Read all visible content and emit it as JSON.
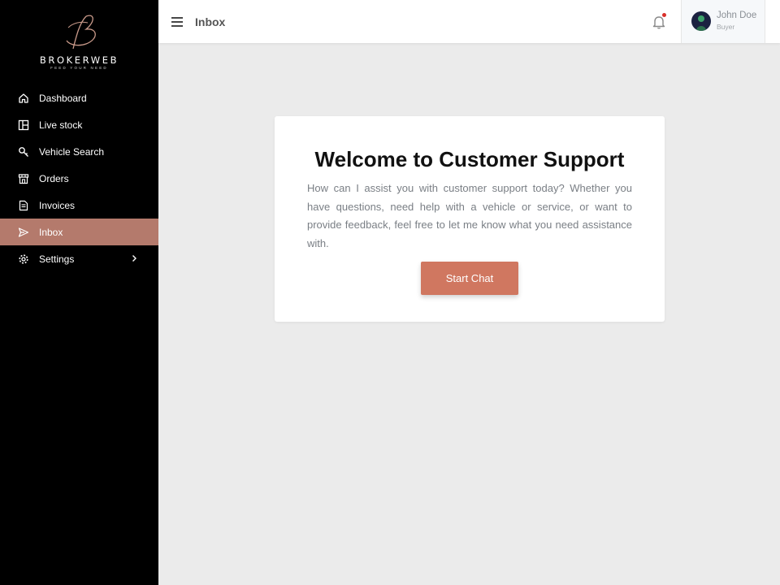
{
  "brand": {
    "name": "BROKERWEB",
    "tagline": "FEED YOUR NEED"
  },
  "sidebar": {
    "items": [
      {
        "label": "Dashboard",
        "icon": "home-icon"
      },
      {
        "label": "Live stock",
        "icon": "layout-icon"
      },
      {
        "label": "Vehicle Search",
        "icon": "key-icon"
      },
      {
        "label": "Orders",
        "icon": "store-icon"
      },
      {
        "label": "Invoices",
        "icon": "invoice-icon"
      },
      {
        "label": "Inbox",
        "icon": "send-icon",
        "active": true
      },
      {
        "label": "Settings",
        "icon": "gear-icon",
        "has_submenu": true
      }
    ]
  },
  "header": {
    "title": "Inbox",
    "notification_dot": true,
    "user": {
      "name": "John Doe",
      "role": "Buyer"
    }
  },
  "main": {
    "title": "Welcome to Customer Support",
    "description": "How can I assist you with customer support today? Whether you have questions, need help with a vehicle or service, or want to provide feedback, feel free to let me know what you need assistance with.",
    "button_label": "Start Chat"
  },
  "colors": {
    "accent": "#d07760",
    "sidebar_active": "#b47a6c",
    "sidebar_bg": "#000000",
    "page_bg": "#ebebeb",
    "notification": "#d9302a"
  }
}
